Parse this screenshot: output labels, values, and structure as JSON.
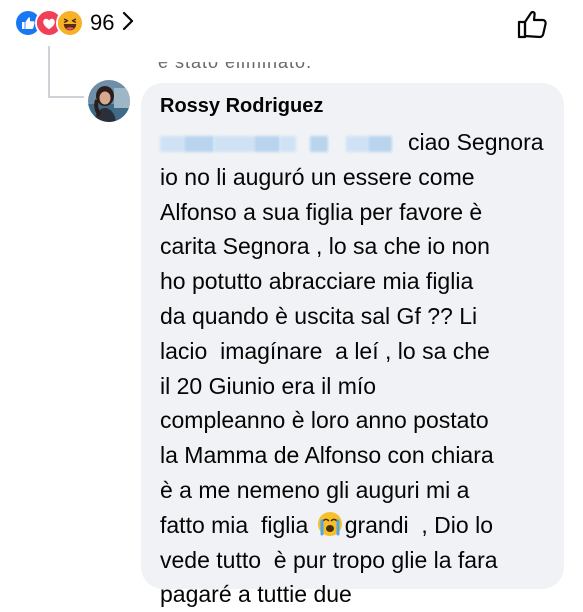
{
  "reactions": {
    "icons": [
      "like-icon",
      "love-icon",
      "haha-icon"
    ],
    "count": "96"
  },
  "hidden_notice": "è stato eliminato.",
  "comment": {
    "author": "Rossy Rodriguez",
    "mention": "ciao Segnora",
    "lines": [
      "io no li auguró un essere come",
      "Alfonso a sua figlia per favore è",
      "carita Segnora , lo sa che io non",
      "ho potutto abracciare mia figlia",
      "da quando è uscita sal Gf ?? Li",
      "lacio  imagínare  a leí , lo sa che",
      "il 20 Giunio era il mío",
      "compleanno è loro anno postato",
      "la Mamma de Alfonso con chiara",
      "è a me nemeno gli auguri mi a"
    ],
    "line_emoji_before": "fatto mia  figlia",
    "line_emoji_after": "grandi  , Dio lo",
    "emoji": "crying-face-emoji",
    "lines_end": [
      "vede tutto  è pur tropo glie la fara",
      "pagaré a tuttie due"
    ]
  },
  "colors": {
    "bubble": "#f0f2f5",
    "like": "#1877f2",
    "love": "#f33e58",
    "haha": "#f7b125",
    "thread": "#cfd2d6"
  }
}
